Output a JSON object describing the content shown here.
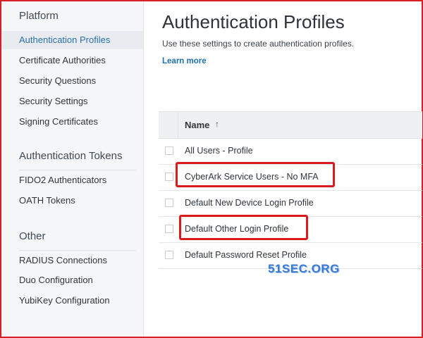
{
  "sidebar": {
    "sections": [
      {
        "title": "Platform",
        "items": [
          "Authentication Profiles",
          "Certificate Authorities",
          "Security Questions",
          "Security Settings",
          "Signing Certificates"
        ]
      },
      {
        "title": "Authentication Tokens",
        "items": [
          "FIDO2 Authenticators",
          "OATH Tokens"
        ]
      },
      {
        "title": "Other",
        "items": [
          "RADIUS Connections",
          "Duo Configuration",
          "YubiKey Configuration"
        ]
      }
    ],
    "active_item": "Authentication Profiles"
  },
  "main": {
    "title": "Authentication Profiles",
    "subtitle": "Use these settings to create authentication profiles.",
    "learn_more": "Learn more"
  },
  "table": {
    "column": "Name",
    "sort_icon": "arrow-up-icon",
    "sort_glyph": "↑",
    "rows": [
      "All Users - Profile",
      "CyberArk Service Users - No MFA",
      "Default New Device Login Profile",
      "Default Other Login Profile",
      "Default Password Reset Profile"
    ],
    "highlighted_rows": [
      1,
      3
    ]
  },
  "watermark": "51SEC.ORG",
  "colors": {
    "highlight": "#d91b20",
    "link": "#1f6fb3",
    "active_nav": "#2c6ea8"
  }
}
